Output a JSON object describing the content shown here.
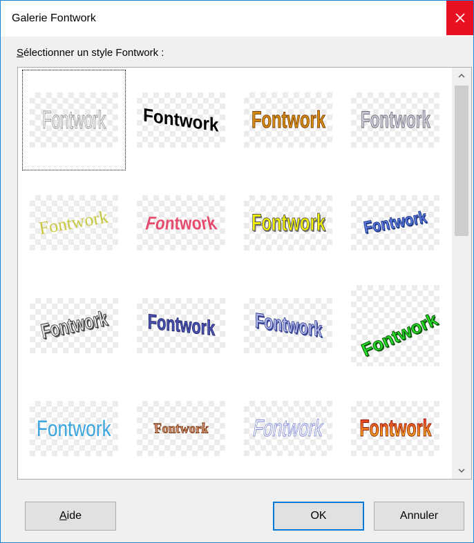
{
  "window": {
    "title": "Galerie Fontwork"
  },
  "prompt": {
    "accel": "S",
    "rest": "électionner un style Fontwork :"
  },
  "gallery": {
    "items": [
      {
        "label": "Fontwork"
      },
      {
        "label": "Fontwork"
      },
      {
        "label": "Fontwork"
      },
      {
        "label": "Fontwork"
      },
      {
        "label": "Fontwork"
      },
      {
        "label": "Fontwork"
      },
      {
        "label": "Fontwork"
      },
      {
        "label": "Fontwork"
      },
      {
        "label": "Fontwork"
      },
      {
        "label": "Fontwork"
      },
      {
        "label": "Fontwork"
      },
      {
        "label": "Fontwork"
      },
      {
        "label": "Fontwork"
      },
      {
        "label": "Fontwork"
      },
      {
        "label": "Fontwork"
      },
      {
        "label": "Fontwork"
      }
    ],
    "selected_index": 0
  },
  "scrollbar": {
    "up_icon": "chevron-up-icon",
    "down_icon": "chevron-down-icon"
  },
  "buttons": {
    "help_accel": "A",
    "help_rest": "ide",
    "ok": "OK",
    "cancel": "Annuler"
  }
}
